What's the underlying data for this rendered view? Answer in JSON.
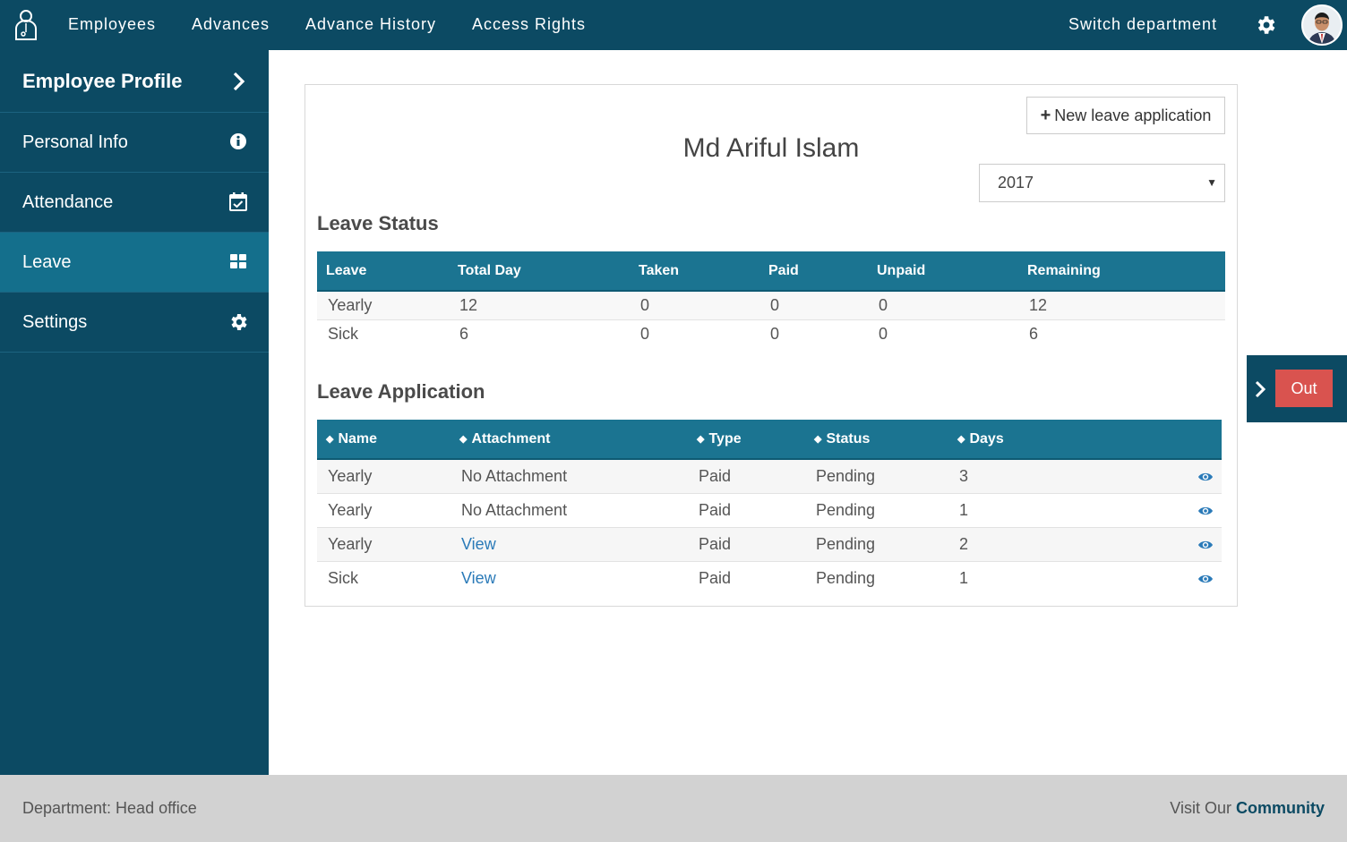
{
  "topnav": {
    "logo_icon": "user-logo-icon",
    "items": [
      "Employees",
      "Advances",
      "Advance History",
      "Access Rights"
    ],
    "switch_department": "Switch department",
    "settings_icon": "gear-icon",
    "avatar_icon": "avatar"
  },
  "sidebar": {
    "header": "Employee Profile",
    "items": [
      {
        "label": "Personal Info",
        "icon": "info-icon"
      },
      {
        "label": "Attendance",
        "icon": "calendar-check-icon"
      },
      {
        "label": "Leave",
        "icon": "grid-icon",
        "active": true
      },
      {
        "label": "Settings",
        "icon": "gear-icon"
      }
    ]
  },
  "main": {
    "new_button": "New leave application",
    "employee_name": "Md Ariful Islam",
    "year_select": "2017",
    "leave_status": {
      "title": "Leave Status",
      "columns": [
        "Leave",
        "Total Day",
        "Taken",
        "Paid",
        "Unpaid",
        "Remaining"
      ],
      "rows": [
        [
          "Yearly",
          "12",
          "0",
          "0",
          "0",
          "12"
        ],
        [
          "Sick",
          "6",
          "0",
          "0",
          "0",
          "6"
        ]
      ]
    },
    "leave_application": {
      "title": "Leave Application",
      "columns": [
        "Name",
        "Attachment",
        "Type",
        "Status",
        "Days"
      ],
      "rows": [
        {
          "name": "Yearly",
          "attachment": "No Attachment",
          "attachment_link": false,
          "type": "Paid",
          "status": "Pending",
          "days": "3"
        },
        {
          "name": "Yearly",
          "attachment": "No Attachment",
          "attachment_link": false,
          "type": "Paid",
          "status": "Pending",
          "days": "1"
        },
        {
          "name": "Yearly",
          "attachment": "View",
          "attachment_link": true,
          "type": "Paid",
          "status": "Pending",
          "days": "2"
        },
        {
          "name": "Sick",
          "attachment": "View",
          "attachment_link": true,
          "type": "Paid",
          "status": "Pending",
          "days": "1"
        }
      ]
    }
  },
  "out_panel": {
    "button": "Out"
  },
  "footer": {
    "department": "Department: Head office",
    "visit_prefix": "Visit Our",
    "community": "Community"
  },
  "colors": {
    "nav_bg": "#0c4a63",
    "sidebar_active": "#146f8c",
    "table_header": "#1b7491",
    "out_button": "#d9534f",
    "link": "#2a7ab8"
  }
}
